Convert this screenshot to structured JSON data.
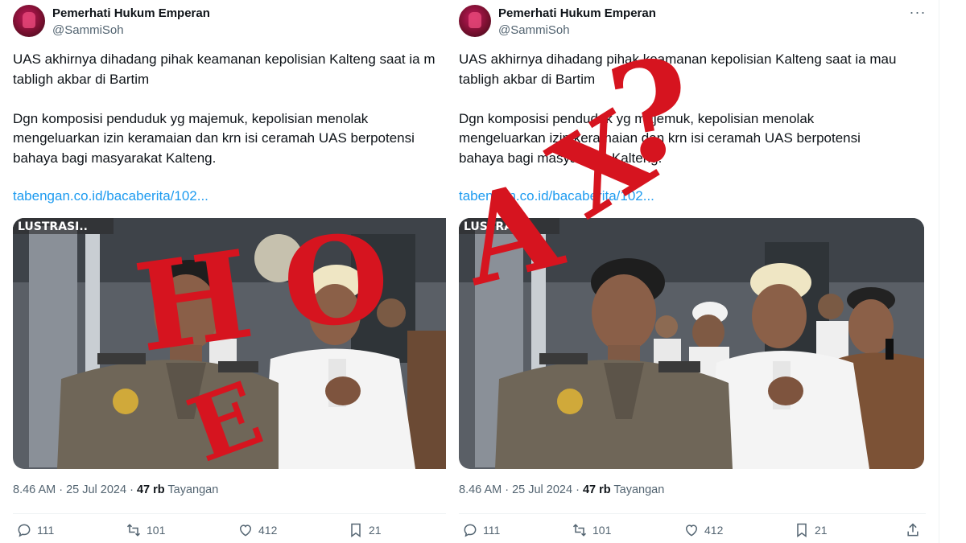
{
  "tweets": [
    {
      "author_name": "Pemerhati Hukum Emperan",
      "author_handle": "@SammiSoh",
      "line1": "UAS akhirnya dihadang pihak keamanan kepolisian Kalteng saat ia m",
      "line2": "tabligh akbar di Bartim",
      "line3": "Dgn komposisi penduduk yg majemuk, kepolisian menolak",
      "line4": "mengeluarkan izin keramaian dan krn isi ceramah UAS berpotensi",
      "line5": "bahaya bagi masyarakat Kalteng.",
      "link": "tabengan.co.id/bacaberita/102...",
      "image_caption": "LUSTRASI..",
      "time": "8.46 AM · 25 Jul 2024 ·",
      "views_count": "47 rb",
      "views_label": "Tayangan",
      "replies": "111",
      "reposts": "101",
      "likes": "412",
      "bookmarks": "21"
    },
    {
      "author_name": "Pemerhati Hukum Emperan",
      "author_handle": "@SammiSoh",
      "line1": "UAS akhirnya dihadang pihak keamanan kepolisian Kalteng saat ia mau",
      "line2": "tabligh akbar di Bartim",
      "line3": "Dgn komposisi penduduk yg majemuk, kepolisian menolak",
      "line4": "mengeluarkan izin keramaian dan krn isi ceramah UAS berpotensi",
      "line5": "bahaya bagi masyarakat Kalteng.",
      "link": "tabengan.co.id/bacaberita/102...",
      "image_caption": "LUSTRASI..",
      "time": "8.46 AM · 25 Jul 2024 ·",
      "views_count": "47 rb",
      "views_label": "Tayangan",
      "replies": "111",
      "reposts": "101",
      "likes": "412",
      "bookmarks": "21",
      "more_icon": "ellipsis-icon",
      "share_icon": "share-icon"
    }
  ],
  "stamp": {
    "left_letters": [
      "H",
      "O"
    ],
    "left_extra": "E",
    "right_letters": [
      "A",
      "X"
    ],
    "right_extra": "?",
    "color": "#d6141f"
  },
  "colors": {
    "link": "#1d9bf0",
    "secondary": "#536471"
  }
}
